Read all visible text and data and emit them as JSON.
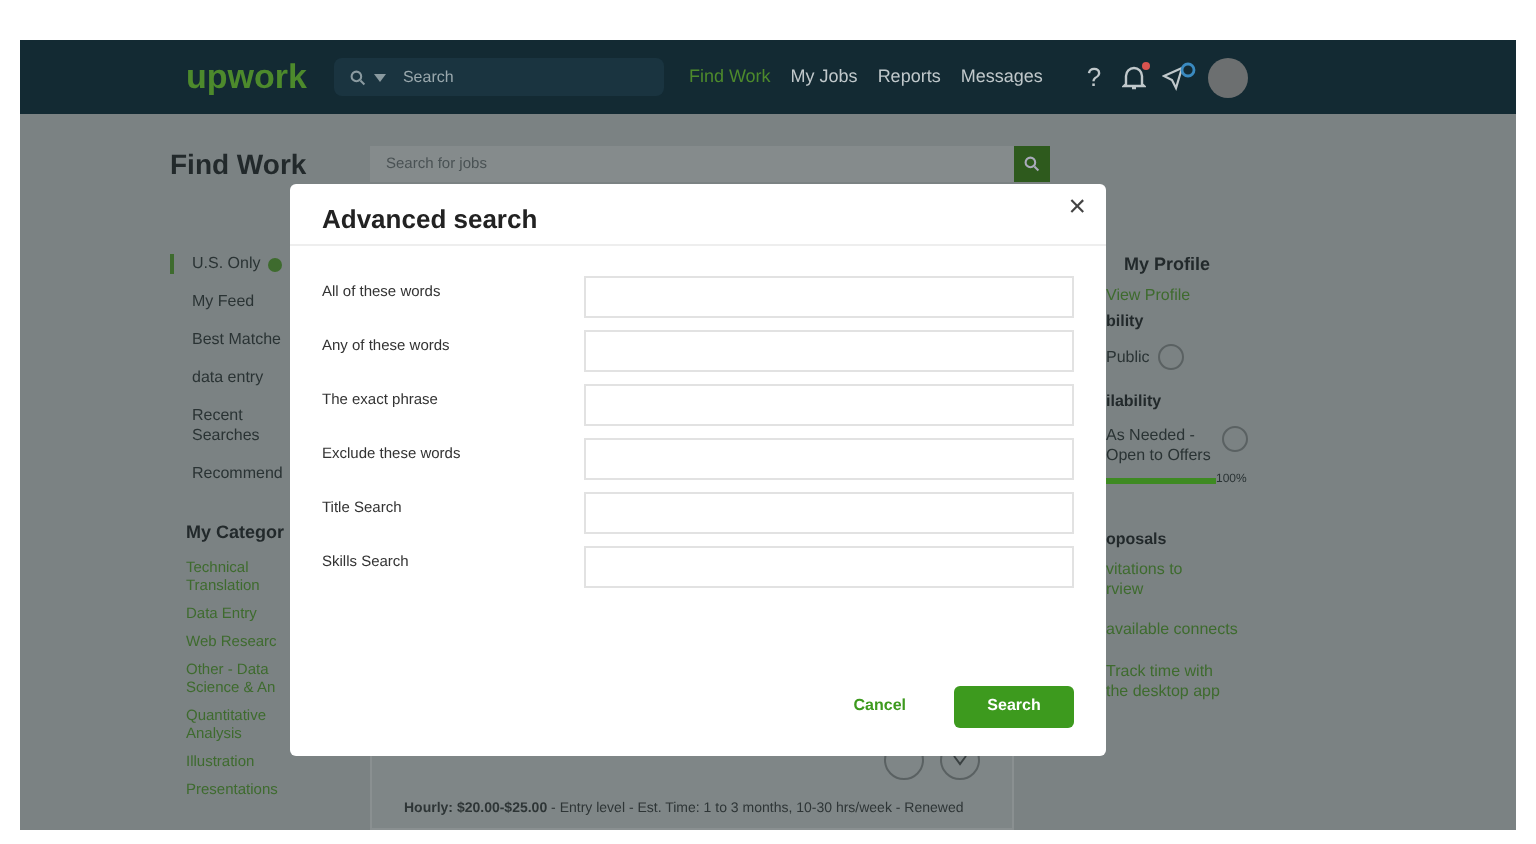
{
  "header": {
    "logo": "upwork",
    "search": {
      "placeholder": "Search"
    },
    "nav": [
      {
        "label": "Find Work",
        "selected": true
      },
      {
        "label": "My Jobs",
        "selected": false
      },
      {
        "label": "Reports",
        "selected": false
      },
      {
        "label": "Messages",
        "selected": false
      }
    ],
    "help": "?",
    "notifications": {
      "unread": true
    }
  },
  "page": {
    "title": "Find Work",
    "search": {
      "placeholder": "Search for jobs"
    },
    "sidebar": {
      "items": [
        {
          "label": "U.S. Only",
          "selected": true
        },
        {
          "label": "My Feed",
          "selected": false
        },
        {
          "label": "Best Matche",
          "selected": false
        },
        {
          "label": "data entry",
          "selected": false
        },
        {
          "label": "Recent Searches",
          "selected": false
        },
        {
          "label": "Recommend",
          "selected": false
        }
      ],
      "categories_title": "My Categor",
      "categories": [
        "Technical Translation",
        "Data Entry",
        "Web Researc",
        "Other - Data Science & An",
        "Quantitative Analysis",
        "Illustration",
        "Presentations"
      ]
    },
    "job": {
      "details": "**Hourly: $20.00-$25.00** - Entry level - Est. Time: 1 to 3 months, 10-30 hrs/week - Renewed"
    },
    "profile": {
      "title": "My Profile",
      "link": "View Profile",
      "visibility_title": "bility",
      "visibility": "Public",
      "availability_title": "ilability",
      "availability": "As Needed - Open to Offers",
      "level": 1.0,
      "percent": "100%",
      "proposals_title": "oposals",
      "invitations": [
        "vitations to",
        "rview"
      ],
      "connects": "available connects",
      "track": "Track time with the desktop app"
    }
  },
  "dialog": {
    "title": "Advanced search",
    "close": "×",
    "fields": [
      {
        "label": "All of these words"
      },
      {
        "label": "Any of these words"
      },
      {
        "label": "The exact phrase"
      },
      {
        "label": "Exclude these words"
      },
      {
        "label": "Title Search"
      },
      {
        "label": "Skills Search"
      }
    ],
    "cancel": "Cancel",
    "submit": "Search"
  }
}
